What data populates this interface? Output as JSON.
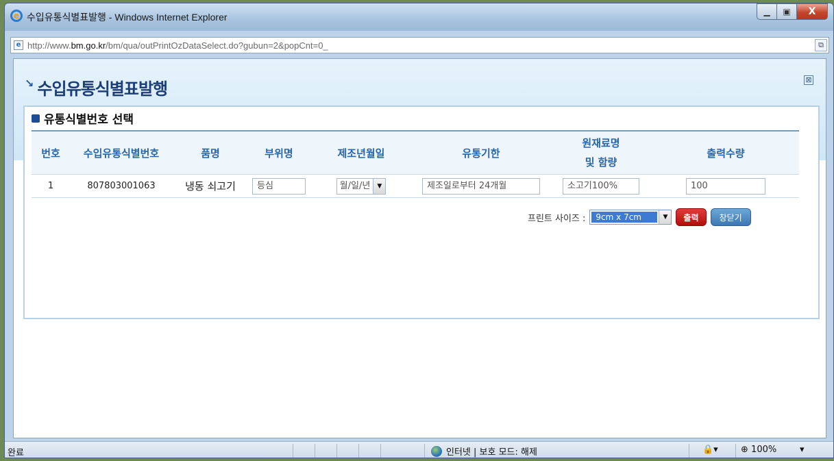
{
  "window": {
    "title": "수입유통식별표발행 - Windows Internet Explorer",
    "minimize": "▁",
    "maximize": "▣",
    "close": "X"
  },
  "address": {
    "url_prefix": "http://www.",
    "url_domain": "bm.go.kr",
    "url_suffix": "/bm/qua/outPrintOzDataSelect.do?gubun=2&popCnt=0_"
  },
  "popup": {
    "title": "수입유통식별표발행",
    "close_icon": "⊠"
  },
  "section": {
    "title": "유통식별번호 선택"
  },
  "table": {
    "headers": {
      "no": "번호",
      "code": "수입유통식별번호",
      "product": "품명",
      "part": "부위명",
      "mfg_date": "제조년월일",
      "expiry": "유통기한",
      "material_line1": "원재료명",
      "material_line2": "및 함량",
      "qty": "출력수량"
    },
    "rows": [
      {
        "no": "1",
        "code": "807803001063",
        "product": "냉동 쇠고기",
        "part": "등심",
        "mfg_date": "월/일/년",
        "expiry": "제조일로부터 24개월",
        "material": "소고기100%",
        "qty": "100"
      }
    ]
  },
  "print": {
    "size_label": "프린트 사이즈 :",
    "size_value": "9cm x 7cm",
    "print_button": "출력",
    "close_button": "창닫기"
  },
  "status": {
    "left": "완료",
    "zone": "인터넷 | 보호 모드: 해제",
    "zoom": "100%"
  }
}
